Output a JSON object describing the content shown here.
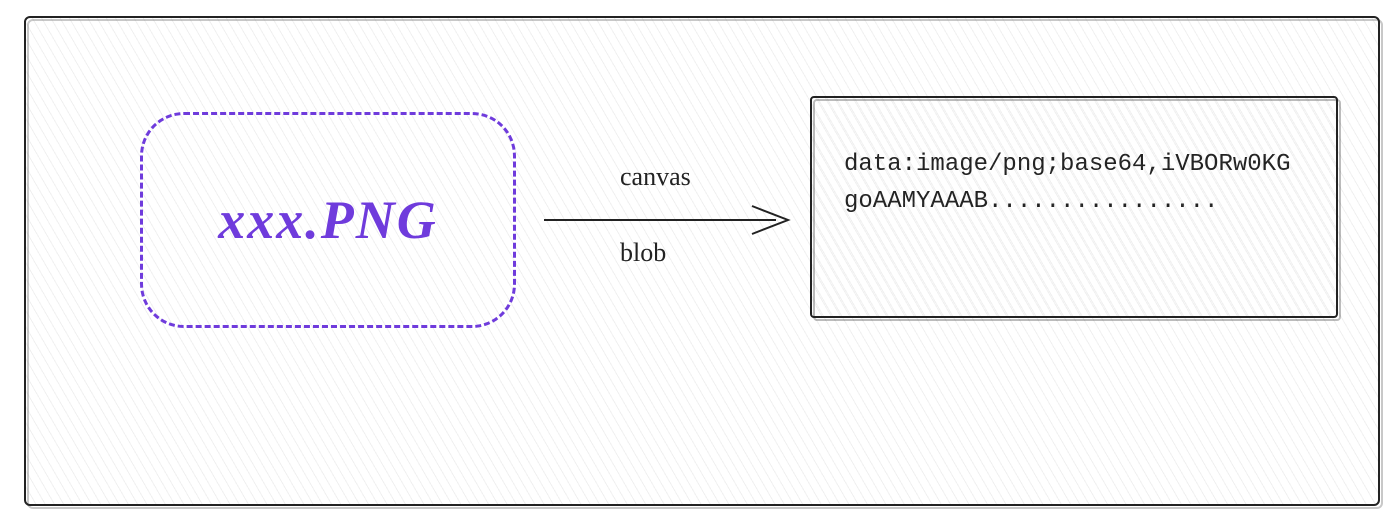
{
  "source": {
    "filename": "xxx.PNG"
  },
  "arrow": {
    "top_label": "canvas",
    "bottom_label": "blob"
  },
  "output": {
    "data_uri": "data:image/png;base64,iVBORw0KGgoAAMYAAAB................"
  }
}
